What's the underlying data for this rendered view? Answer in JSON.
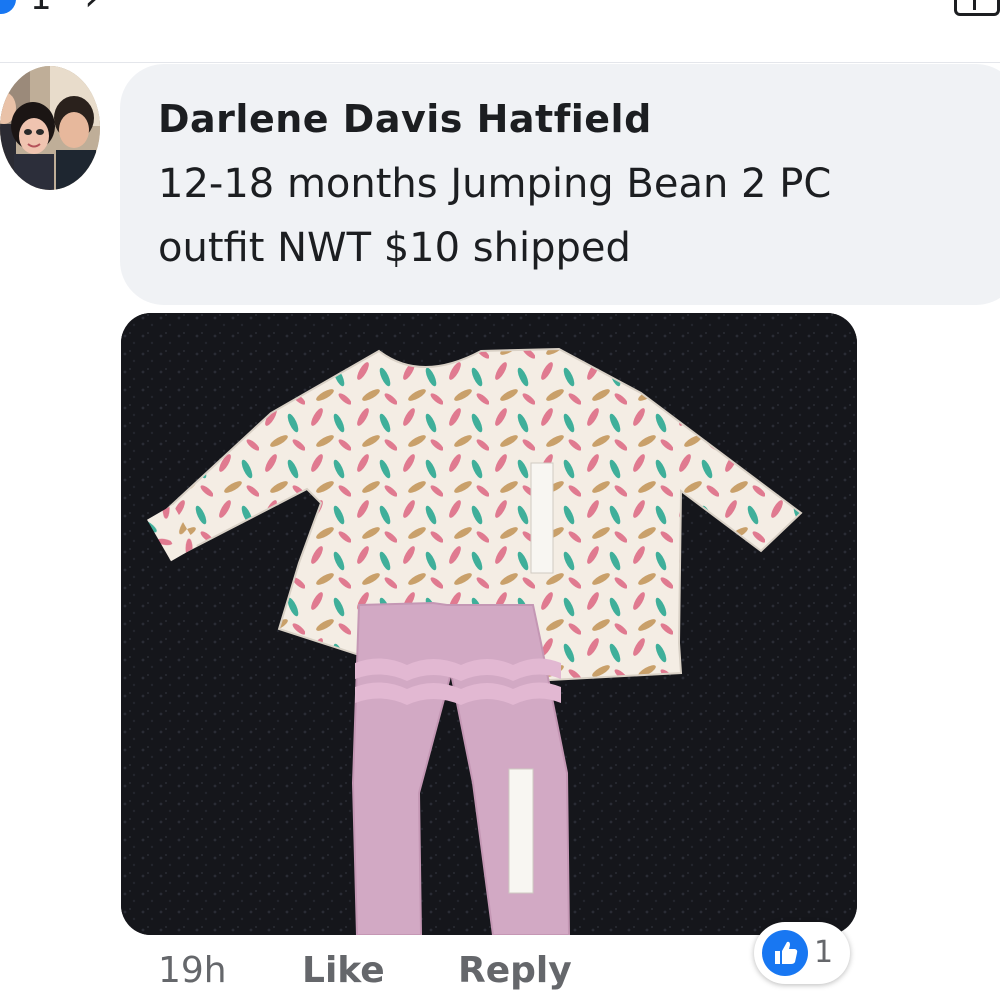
{
  "topbar": {
    "partial_number": "1",
    "partial_arrow": "›",
    "right_icon": "open-window-icon"
  },
  "comment": {
    "author": "Darlene Davis Hatfield",
    "text_line1": "12-18 months Jumping Bean 2 PC",
    "text_line2": "outfit NWT $10 shipped",
    "avatar_icon": "profile-photo",
    "photo_icon": "outfit-photo"
  },
  "actions": {
    "time": "19h",
    "like_label": "Like",
    "reply_label": "Reply"
  },
  "reactions": {
    "icon": "thumbs-up-icon",
    "count": "1"
  },
  "colors": {
    "accent": "#1877f2",
    "bubble_bg": "#f0f2f5",
    "meta_text": "#65676b",
    "primary_text": "#1c1e21"
  }
}
